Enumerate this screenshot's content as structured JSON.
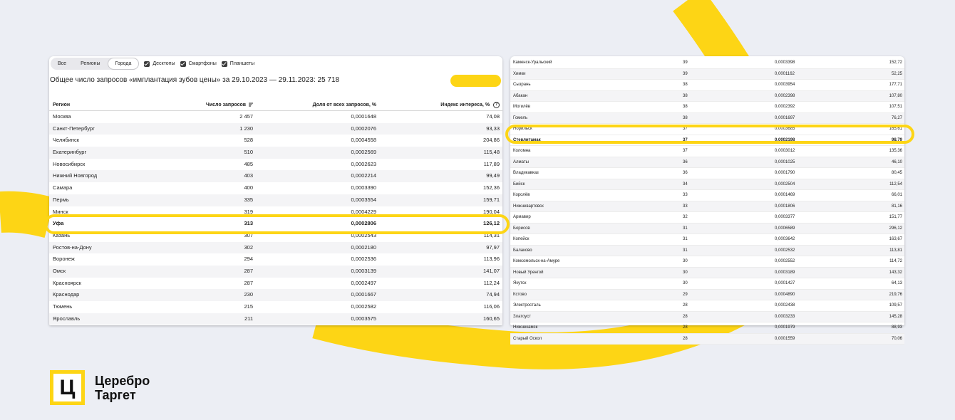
{
  "toolbar": {
    "tabs": [
      "Все",
      "Регионы",
      "Города"
    ],
    "active_tab": "Города",
    "checkboxes": [
      "Десктопы",
      "Смартфоны",
      "Планшеты"
    ]
  },
  "summary": "Общее число запросов «имплантация зубов цены» за 29.10.2023 — 29.11.2023: 25 718",
  "left_table": {
    "headers": [
      "Регион",
      "Число запросов",
      "Доля от всех запросов, %",
      "Индекс интереса, %"
    ],
    "rows": [
      [
        "Москва",
        "2 457",
        "0,0001648",
        "74,08"
      ],
      [
        "Санкт-Петербург",
        "1 230",
        "0,0002076",
        "93,33"
      ],
      [
        "Челябинск",
        "528",
        "0,0004558",
        "204,86"
      ],
      [
        "Екатеринбург",
        "510",
        "0,0002569",
        "115,48"
      ],
      [
        "Новосибирск",
        "485",
        "0,0002623",
        "117,89"
      ],
      [
        "Нижний Новгород",
        "403",
        "0,0002214",
        "99,49"
      ],
      [
        "Самара",
        "400",
        "0,0003390",
        "152,36"
      ],
      [
        "Пермь",
        "335",
        "0,0003554",
        "159,71"
      ],
      [
        "Минск",
        "319",
        "0,0004229",
        "190,04"
      ],
      [
        "Уфа",
        "313",
        "0,0002806",
        "126,12"
      ],
      [
        "Казань",
        "307",
        "0,0002543",
        "114,31"
      ],
      [
        "Ростов-на-Дону",
        "302",
        "0,0002180",
        "97,97"
      ],
      [
        "Воронеж",
        "294",
        "0,0002536",
        "113,96"
      ],
      [
        "Омск",
        "287",
        "0,0003139",
        "141,07"
      ],
      [
        "Красноярск",
        "287",
        "0,0002497",
        "112,24"
      ],
      [
        "Краснодар",
        "230",
        "0,0001667",
        "74,94"
      ],
      [
        "Тюмень",
        "215",
        "0,0002582",
        "116,06"
      ],
      [
        "Ярославль",
        "211",
        "0,0003575",
        "160,65"
      ]
    ],
    "highlight_row": "Уфа"
  },
  "right_table": {
    "rows": [
      [
        "Каменск-Уральский",
        "39",
        "0,0003398",
        "152,72"
      ],
      [
        "Химки",
        "39",
        "0,0001162",
        "52,25"
      ],
      [
        "Сызрань",
        "38",
        "0,0003954",
        "177,71"
      ],
      [
        "Абакан",
        "38",
        "0,0002398",
        "107,80"
      ],
      [
        "Могилёв",
        "38",
        "0,0002392",
        "107,51"
      ],
      [
        "Гомель",
        "38",
        "0,0001697",
        "76,27"
      ],
      [
        "Норильск",
        "37",
        "0,0003685",
        "165,61"
      ],
      [
        "Стерлитамак",
        "37",
        "0,0002198",
        "98,79"
      ],
      [
        "Коломна",
        "37",
        "0,0003012",
        "135,36"
      ],
      [
        "Алматы",
        "36",
        "0,0001025",
        "46,10"
      ],
      [
        "Владикавказ",
        "36",
        "0,0001790",
        "80,45"
      ],
      [
        "Бийск",
        "34",
        "0,0002504",
        "112,54"
      ],
      [
        "Королёв",
        "33",
        "0,0001469",
        "66,01"
      ],
      [
        "Нижневартовск",
        "33",
        "0,0001806",
        "81,16"
      ],
      [
        "Армавир",
        "32",
        "0,0003377",
        "151,77"
      ],
      [
        "Борисов",
        "31",
        "0,0006589",
        "296,12"
      ],
      [
        "Копейск",
        "31",
        "0,0003642",
        "163,67"
      ],
      [
        "Балаково",
        "31",
        "0,0002532",
        "113,81"
      ],
      [
        "Комсомольск-на-Амуре",
        "30",
        "0,0002552",
        "114,72"
      ],
      [
        "Новый Уренгой",
        "30",
        "0,0003189",
        "143,32"
      ],
      [
        "Якутск",
        "30",
        "0,0001427",
        "64,13"
      ],
      [
        "Кстово",
        "29",
        "0,0004890",
        "219,76"
      ],
      [
        "Электросталь",
        "28",
        "0,0002438",
        "109,57"
      ],
      [
        "Златоуст",
        "28",
        "0,0003233",
        "145,28"
      ],
      [
        "Нижнекамск",
        "28",
        "0,0001979",
        "88,93"
      ],
      [
        "Старый Оскол",
        "28",
        "0,0001559",
        "70,06"
      ]
    ],
    "highlight_row": "Стерлитамак"
  },
  "logo": {
    "glyph": "Ц",
    "line1": "Церебро",
    "line2": "Таргет"
  },
  "colors": {
    "accent_yellow": "#fdd515",
    "background": "#eceef4"
  }
}
